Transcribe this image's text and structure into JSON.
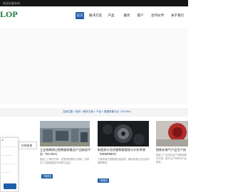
{
  "topbar": {
    "text": "欢迎光临本站"
  },
  "logo": {
    "text": "LOP"
  },
  "nav": [
    {
      "label": "首页"
    },
    {
      "label": "解决方案"
    },
    {
      "label": "产品"
    },
    {
      "label": "服务"
    },
    {
      "label": "客户"
    },
    {
      "label": "合作伙伴"
    },
    {
      "label": "关于我们"
    }
  ],
  "breadcrumb": {
    "text": "当前位置 > 首页 > 解决方案 > 产品 > 数据采集平台（SCADA）"
  },
  "cards": [
    {
      "title": "工业物联网过程数据采集及产品制造平台（SCADA）",
      "desc": "智能工厂解决方案，完整的制造执行系统，实现生产过程数据实时采集与监控。",
      "button": "了解更多"
    },
    {
      "title": "制造执行及质量数据管理与分析系统（MOM/MES）",
      "desc": "汇集质量过程数据实现追溯，满足制造业企业质量管理需求。",
      "button": "了解更多"
    },
    {
      "title": "智能化电气产品生产线",
      "desc": "智能工厂自动化生产线整体解决方案，提升生产效率与产品质量。",
      "button": "了解更多"
    }
  ],
  "chat": {
    "tab_label": "在线咨询",
    "close_glyph": "×"
  }
}
